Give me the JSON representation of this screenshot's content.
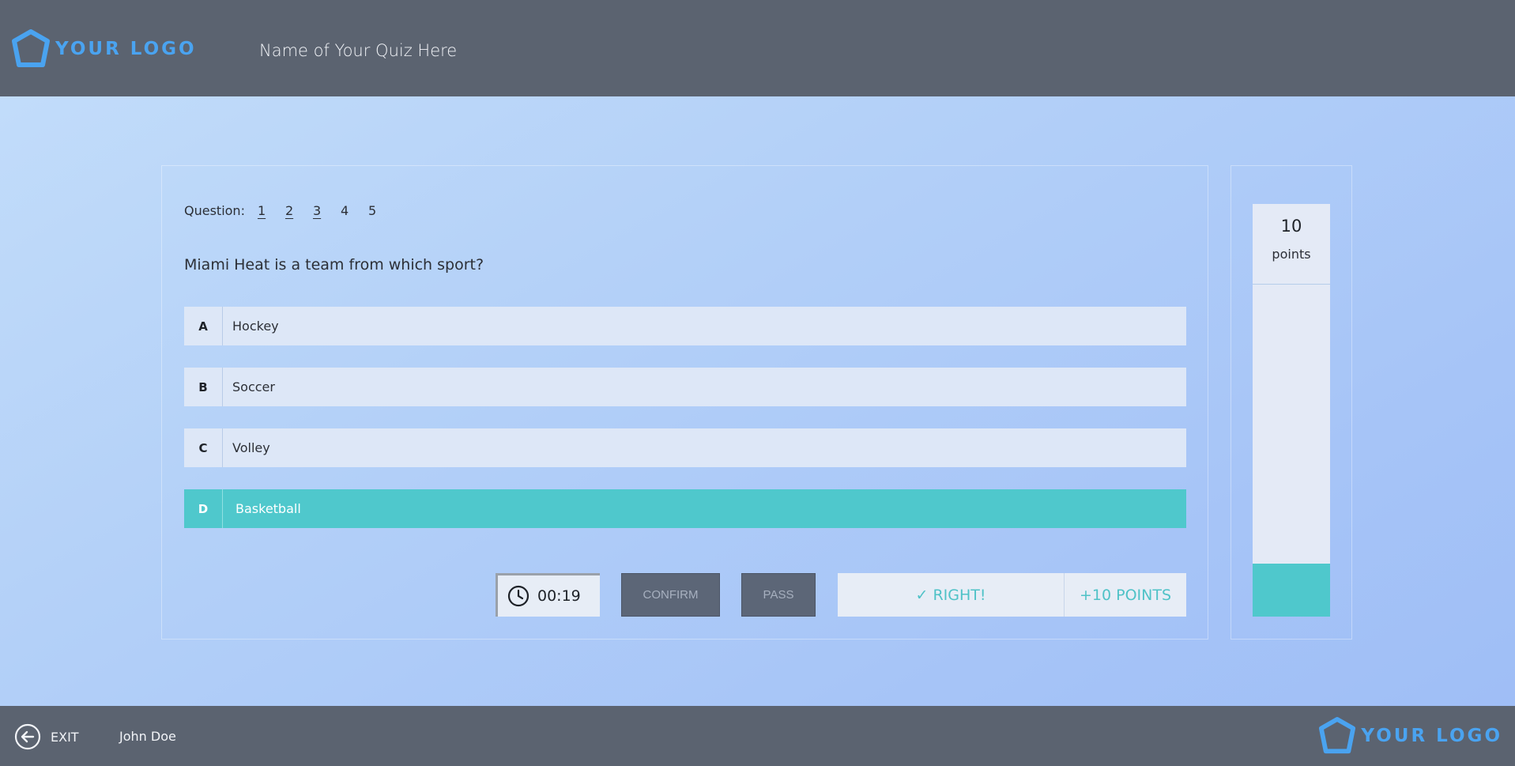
{
  "header": {
    "logo_text": "YOUR LOGO",
    "quiz_title": "Name of Your Quiz Here"
  },
  "question_nav": {
    "label": "Question:",
    "numbers": [
      "1",
      "2",
      "3",
      "4",
      "5"
    ],
    "completed": [
      true,
      true,
      true,
      false,
      false
    ]
  },
  "question": {
    "text": "Miami Heat is a team from which sport?"
  },
  "answers": [
    {
      "letter": "A",
      "text": "Hockey",
      "selected": false
    },
    {
      "letter": "B",
      "text": "Soccer",
      "selected": false
    },
    {
      "letter": "C",
      "text": "Volley",
      "selected": false
    },
    {
      "letter": "D",
      "text": "Basketball",
      "selected": true
    }
  ],
  "controls": {
    "timer": "00:19",
    "confirm_label": "CONFIRM",
    "pass_label": "PASS",
    "feedback_text": "✓ RIGHT!",
    "feedback_points": "+10 POINTS"
  },
  "score": {
    "value": "10",
    "label": "points",
    "progress_fraction": 0.16
  },
  "footer": {
    "exit_label": "EXIT",
    "username": "John Doe",
    "logo_text": "YOUR LOGO"
  },
  "colors": {
    "accent": "#4fc8cc",
    "bar": "#5b6370",
    "logo": "#4aa3f0",
    "button": "#5c6677"
  }
}
